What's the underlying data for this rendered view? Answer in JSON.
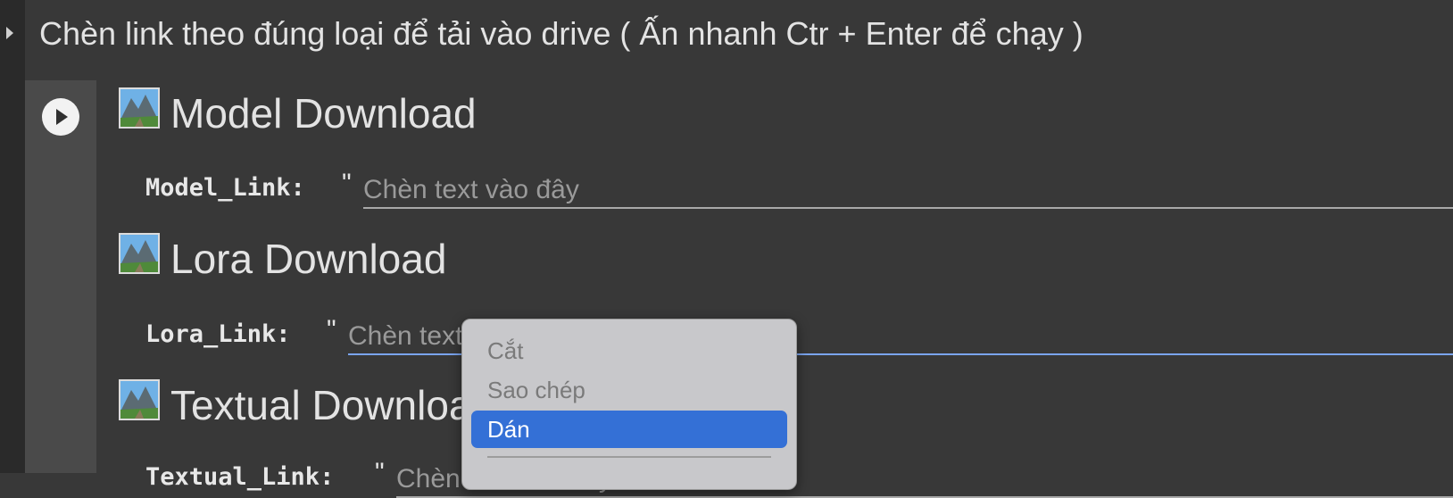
{
  "section": {
    "title": "Chèn link theo đúng loại để tải vào drive ( Ấn nhanh Ctr + Enter để chạy )"
  },
  "forms": [
    {
      "heading": "Model Download",
      "label": "Model_Link:",
      "quote": "\"",
      "placeholder": "Chèn text vào đây",
      "focused": false
    },
    {
      "heading": "Lora Download",
      "label": "Lora_Link:",
      "quote": "\"",
      "placeholder": "Chèn text vào đây",
      "focused": true
    },
    {
      "heading": "Textual Download",
      "label": "Textual_Link:",
      "quote": "\"",
      "placeholder": "Chèn text vào đây",
      "focused": false
    }
  ],
  "context_menu": {
    "items": [
      {
        "label": "Cắt",
        "state": "disabled"
      },
      {
        "label": "Sao chép",
        "state": "disabled"
      },
      {
        "label": "Dán",
        "state": "highlighted"
      }
    ]
  },
  "colors": {
    "accent": "#3470d6",
    "focus_underline": "#7aa4ef",
    "background": "#383838"
  }
}
